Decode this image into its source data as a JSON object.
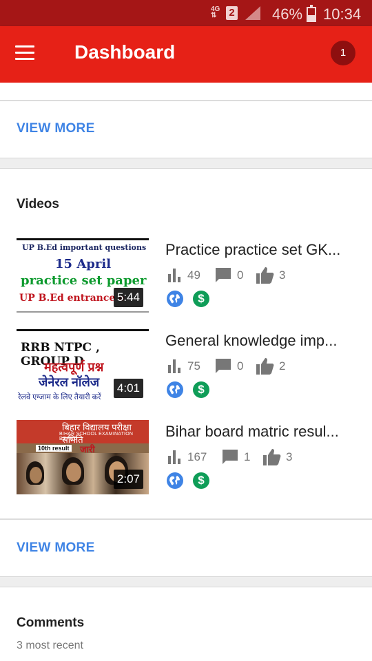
{
  "status_bar": {
    "network": "4G",
    "sim": "2",
    "battery_text": "46%",
    "battery_level": 0.46,
    "time": "10:34"
  },
  "app_bar": {
    "menu_icon": "hamburger-menu-icon",
    "title": "Dashboard",
    "notification_count": "1"
  },
  "top_section": {
    "view_more": "VIEW MORE"
  },
  "videos": {
    "title": "Videos",
    "items": [
      {
        "title": "Practice practice set GK...",
        "duration": "5:44",
        "views": "49",
        "comments": "0",
        "likes": "3",
        "thumb_text": [
          "UP B.Ed important questions",
          "15 April",
          "practice set paper",
          "UP B.Ed entrance e"
        ]
      },
      {
        "title": "General knowledge imp...",
        "duration": "4:01",
        "views": "75",
        "comments": "0",
        "likes": "2",
        "thumb_text": [
          "RRB NTPC , GROUP D",
          "महत्वपूर्ण प्रश्न",
          "जेनेरल नॉलेज",
          "रेलवे एग्जाम के लिए तैयारी करें"
        ]
      },
      {
        "title": "Bihar board matric resul...",
        "duration": "2:07",
        "views": "167",
        "comments": "1",
        "likes": "3",
        "thumb_text": [
          "बिहार विद्यालय परीक्षा समिति",
          "BIHAR SCHOOL EXAMINATION BOARD",
          "10th result",
          "जारी"
        ]
      }
    ],
    "view_more": "VIEW MORE"
  },
  "comments": {
    "title": "Comments",
    "subtitle": "3 most recent"
  },
  "colors": {
    "app_bar": "#e62117",
    "status_bar": "#a51616",
    "link": "#3f84e5",
    "globe_badge": "#3f84e5",
    "monetized_badge": "#0f9d58"
  }
}
